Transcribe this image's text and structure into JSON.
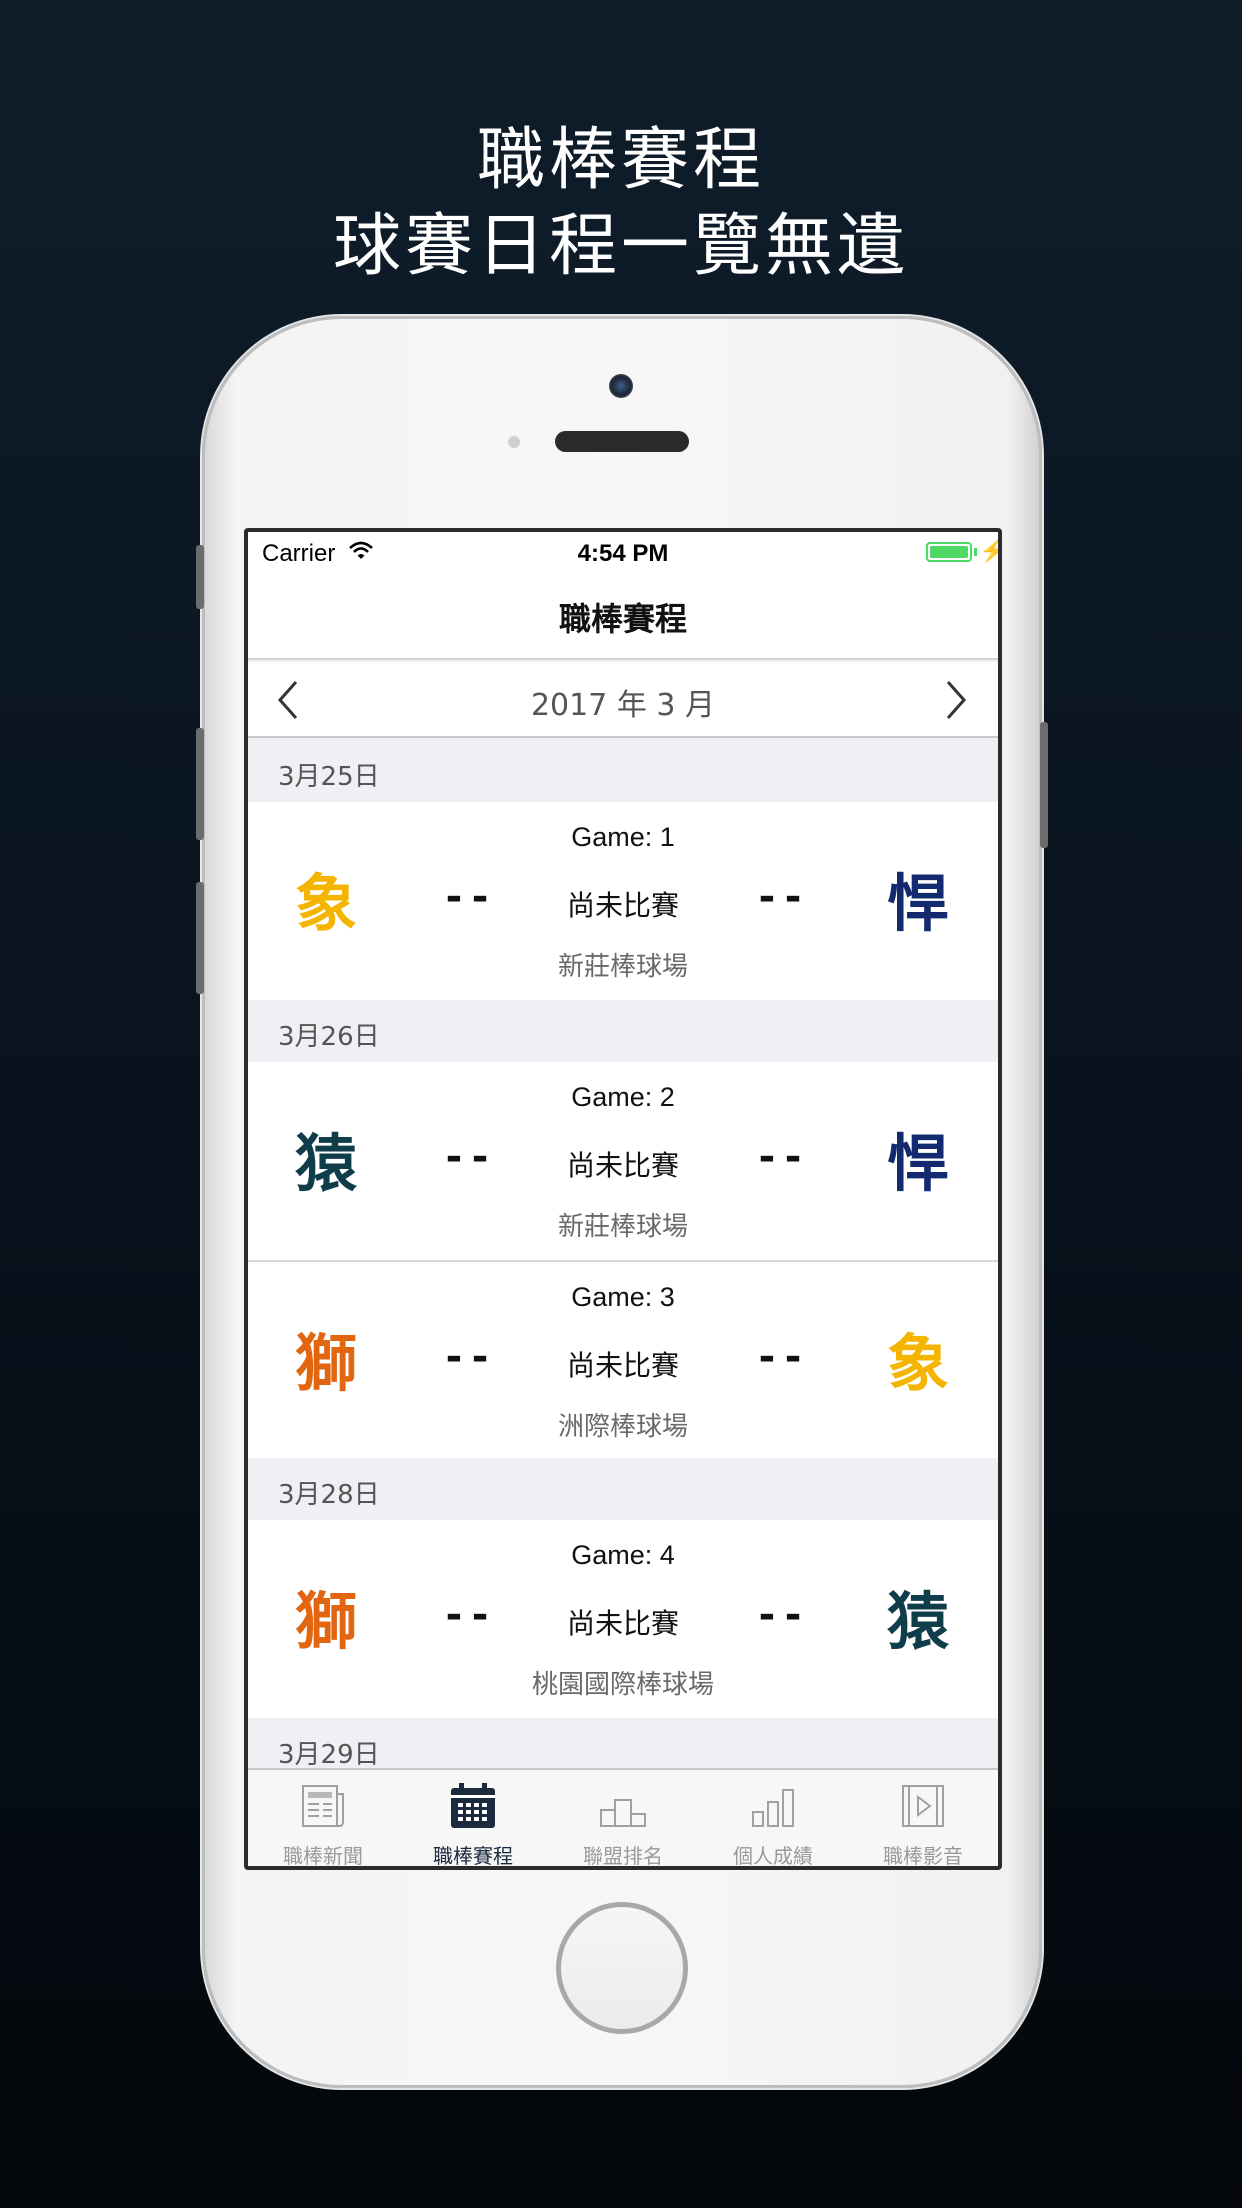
{
  "promo": {
    "title_line1": "職棒賽程",
    "title_line2": "球賽日程一覽無遺"
  },
  "status_bar": {
    "carrier": "Carrier",
    "time": "4:54 PM"
  },
  "nav": {
    "title": "職棒賽程"
  },
  "month_selector": {
    "label": "2017 年 3 月",
    "prev_icon": "chevron-left-icon",
    "next_icon": "chevron-right-icon"
  },
  "schedule": [
    {
      "date": "3月25日",
      "games": [
        {
          "game_no": "Game: 1",
          "home": "象",
          "away": "悍",
          "home_score": "--",
          "away_score": "--",
          "status": "尚未比賽",
          "venue": "新莊棒球場",
          "home_color": "#f5b400",
          "away_color": "#142a6e"
        }
      ]
    },
    {
      "date": "3月26日",
      "games": [
        {
          "game_no": "Game: 2",
          "home": "猿",
          "away": "悍",
          "home_score": "--",
          "away_score": "--",
          "status": "尚未比賽",
          "venue": "新莊棒球場",
          "home_color": "#0f3d4a",
          "away_color": "#142a6e"
        },
        {
          "game_no": "Game: 3",
          "home": "獅",
          "away": "象",
          "home_score": "--",
          "away_score": "--",
          "status": "尚未比賽",
          "venue": "洲際棒球場",
          "home_color": "#e2660f",
          "away_color": "#f5b400"
        }
      ]
    },
    {
      "date": "3月28日",
      "games": [
        {
          "game_no": "Game: 4",
          "home": "獅",
          "away": "猿",
          "home_score": "--",
          "away_score": "--",
          "status": "尚未比賽",
          "venue": "桃園國際棒球場",
          "home_color": "#e2660f",
          "away_color": "#0f3d4a"
        }
      ]
    },
    {
      "date": "3月29日",
      "games": []
    }
  ],
  "tab_bar": [
    {
      "label": "職棒新聞",
      "icon": "newspaper-icon",
      "active": false
    },
    {
      "label": "職棒賽程",
      "icon": "calendar-icon",
      "active": true
    },
    {
      "label": "聯盟排名",
      "icon": "podium-icon",
      "active": false
    },
    {
      "label": "個人成績",
      "icon": "bar-chart-icon",
      "active": false
    },
    {
      "label": "職棒影音",
      "icon": "video-icon",
      "active": false
    }
  ],
  "colors": {
    "tab_active": "#1b2a3f",
    "tab_inactive": "#9a9a9a",
    "battery": "#4cd964"
  }
}
